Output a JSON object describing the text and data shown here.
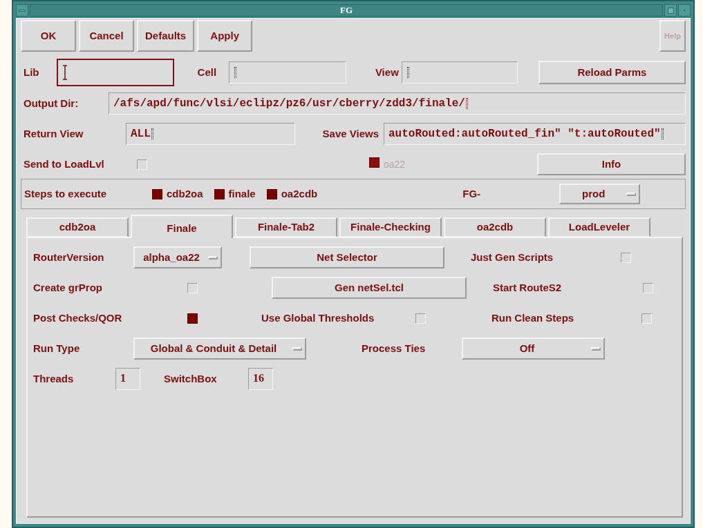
{
  "window": {
    "title": "FG"
  },
  "buttons": [
    {
      "label": "OK",
      "disabled": false
    },
    {
      "label": "Cancel",
      "disabled": false
    },
    {
      "label": "Defaults",
      "disabled": false
    },
    {
      "label": "Apply",
      "disabled": false
    },
    {
      "label": "Help",
      "disabled": true
    }
  ],
  "lib": {
    "label": "Lib",
    "focused": true
  },
  "cell": {
    "label": "Cell",
    "focused": false
  },
  "view": {
    "label": "View",
    "focused": false
  },
  "reload_button": "Reload Parms",
  "output_dir": {
    "label": "Output Dir:",
    "value": "/afs/apd/func/vlsi/eclipz/pz6/usr/cberry/zdd3/finale/"
  },
  "return_view": {
    "label": "Return View",
    "value": "ALL"
  },
  "save_views": {
    "label": "Save Views",
    "value": "autoRouted:autoRouted_fin\" \"t:autoRouted\""
  },
  "send_to_loadlvl": {
    "label": "Send to LoadLvl",
    "checked": false
  },
  "oa22": {
    "label": "oa22",
    "checked": true,
    "disabled": true
  },
  "info_button": "Info",
  "steps": {
    "label": "Steps to execute",
    "items": [
      {
        "label": "cdb2oa",
        "checked": true
      },
      {
        "label": "finale",
        "checked": true
      },
      {
        "label": "oa2cdb",
        "checked": true
      }
    ],
    "fg_label": "FG-",
    "fg_value": "prod"
  },
  "tabs": [
    {
      "label": "cdb2oa",
      "selected": false
    },
    {
      "label": "Finale",
      "selected": true
    },
    {
      "label": "Finale-Tab2",
      "selected": false
    },
    {
      "label": "Finale-Checking",
      "selected": false
    },
    {
      "label": "oa2cdb",
      "selected": false
    },
    {
      "label": "LoadLeveler",
      "selected": false
    }
  ],
  "finale_tab": {
    "rows": [
      {
        "items": [
          {
            "kind": "label",
            "text": "RouterVersion"
          },
          {
            "kind": "dropdown",
            "value": "alpha_oa22"
          },
          {
            "kind": "button",
            "text": "Net Selector"
          },
          {
            "kind": "label",
            "text": "Just Gen Scripts"
          },
          {
            "kind": "checkbox",
            "checked": false
          }
        ]
      },
      {
        "items": [
          {
            "kind": "label",
            "text": "Create grProp"
          },
          {
            "kind": "checkbox",
            "checked": false
          },
          {
            "kind": "button",
            "text": "Gen netSel.tcl"
          },
          {
            "kind": "label",
            "text": "Start RouteS2"
          },
          {
            "kind": "checkbox",
            "checked": false
          }
        ]
      },
      {
        "items": [
          {
            "kind": "label",
            "text": "Post Checks/QOR"
          },
          {
            "kind": "checkbox",
            "checked": true
          },
          {
            "kind": "label",
            "text": "Use Global Thresholds"
          },
          {
            "kind": "checkbox",
            "checked": false
          },
          {
            "kind": "label",
            "text": "Run Clean Steps"
          },
          {
            "kind": "checkbox",
            "checked": false
          }
        ]
      },
      {
        "items": [
          {
            "kind": "label",
            "text": "Run Type"
          },
          {
            "kind": "dropdown",
            "value": "Global & Conduit & Detail"
          },
          {
            "kind": "label",
            "text": "Process Ties"
          },
          {
            "kind": "dropdown",
            "value": "Off"
          }
        ]
      },
      {
        "items": [
          {
            "kind": "label",
            "text": "Threads"
          },
          {
            "kind": "field",
            "value": "1"
          },
          {
            "kind": "label",
            "text": "SwitchBox"
          },
          {
            "kind": "field",
            "value": "16"
          }
        ]
      }
    ]
  }
}
